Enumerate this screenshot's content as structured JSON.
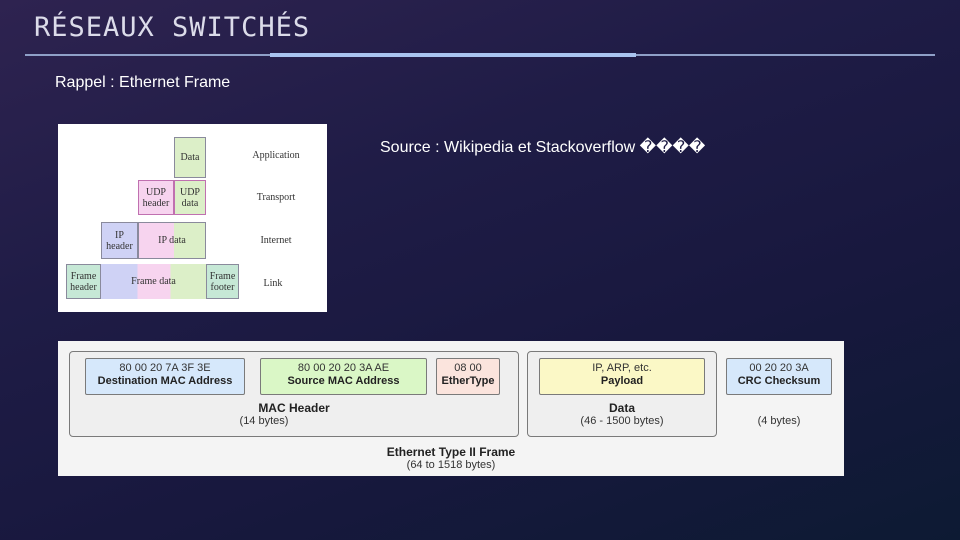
{
  "header": {
    "title": "RÉSEAUX SWITCHÉS",
    "subtitle": "Rappel : Ethernet Frame",
    "source_note": "Source : Wikipedia et Stackoverflow ����"
  },
  "stack_diagram": {
    "cells": {
      "data": "Data",
      "udp_header": "UDP header",
      "udp_data": "UDP data",
      "ip_header": "IP header",
      "ip_data": "IP data",
      "frame_header": "Frame header",
      "frame_data": "Frame data",
      "frame_footer": "Frame footer"
    },
    "layers": [
      "Application",
      "Transport",
      "Internet",
      "Link"
    ]
  },
  "frame_diagram": {
    "fields": {
      "dst_mac": {
        "hex": "80  00  20  7A  3F  3E",
        "name": "Destination MAC Address"
      },
      "src_mac": {
        "hex": "80  00  20  20  3A  AE",
        "name": "Source MAC Address"
      },
      "ethertype": {
        "hex": "08  00",
        "name": "EtherType"
      },
      "payload": {
        "hex": "IP, ARP, etc.",
        "name": "Payload"
      },
      "crc": {
        "hex": "00  20  20  3A",
        "name": "CRC Checksum"
      }
    },
    "mac_header": {
      "title": "MAC Header",
      "size": "(14 bytes)"
    },
    "data": {
      "title": "Data",
      "size": "(46 - 1500 bytes)"
    },
    "crc_size": "(4 bytes)",
    "frame": {
      "title": "Ethernet Type II Frame",
      "size": "(64 to 1518 bytes)"
    }
  }
}
